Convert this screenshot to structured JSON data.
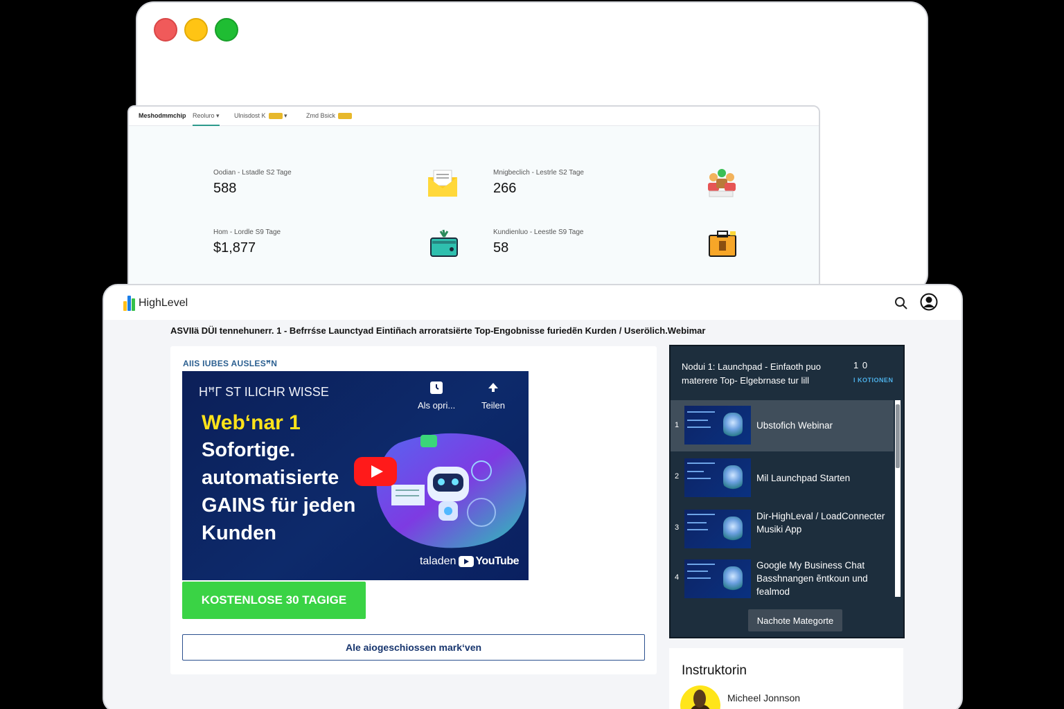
{
  "dashboard": {
    "nav": {
      "brand": "Meshodmmchip",
      "items": [
        "Reoluro",
        "Ulnisdost K",
        "Zmd Bsick"
      ]
    },
    "stats": [
      {
        "label": "Oodian - Lstadle S2 Tage",
        "value": "588",
        "icon": "mail-envelope-icon"
      },
      {
        "label": "Mnigbeclich - Lestrle S2 Tage",
        "value": "266",
        "icon": "people-group-icon"
      },
      {
        "label": "Hom - Lordle S9 Tage",
        "value": "$1,877",
        "icon": "wallet-icon"
      },
      {
        "label": "Kundienluo - Leestle S9 Tage",
        "value": "58",
        "icon": "briefcase-icon"
      }
    ]
  },
  "app": {
    "logo_text": "HighLevel",
    "breadcrumb": "ASVIIä DÜI tennehunerr. 1 - Befrrśse Launctyad  Eintiñach  arroratsiërte Top-Engobnisse furiedẽn Kurden  /  Userölich.Webimar"
  },
  "main": {
    "section_title": "AIIS IUBES AUSLESꟸN",
    "video": {
      "top_text": "HꟸГ ST ILICHR WISSE",
      "title_yellow": "Webʻnar 1",
      "title_lines": [
        "Sofortige.",
        "automatisierte",
        "GAINS für jeden",
        "Kunden"
      ],
      "watch_later": "Als opri...",
      "share": "Teilen",
      "yt_prefix": "taladen",
      "yt_word": "YouTube"
    },
    "cta_label": "KOSTENLOSE 30 TAGIGE",
    "mark_all_label": "Ale aiogeschiossen markʻven"
  },
  "module": {
    "title": "Nodui 1: Launchpad - Einfaoth puo materere  Top- Elgebrnase tur lill",
    "count": "1 0",
    "count_label": "I KOTIONEN",
    "lessons": [
      {
        "num": "1",
        "title": "Ubstofich Webinar"
      },
      {
        "num": "2",
        "title": "Mil Launchpad Starten"
      },
      {
        "num": "3",
        "title": "Dir-HighLeval / LoadConnecter Musiki App"
      },
      {
        "num": "4",
        "title": "Google My Business Chat Basshnangen ẽntkoun  und fealmod"
      }
    ],
    "next_label": "Nachote Mategorte"
  },
  "instructor": {
    "title": "Instruktorin",
    "name": "Micheel Jonnson"
  },
  "colors": {
    "accent_green": "#3ad345",
    "panel_dark": "#1d2e3d",
    "link_blue": "#17356e",
    "youtube_red": "#ff1a1a"
  }
}
